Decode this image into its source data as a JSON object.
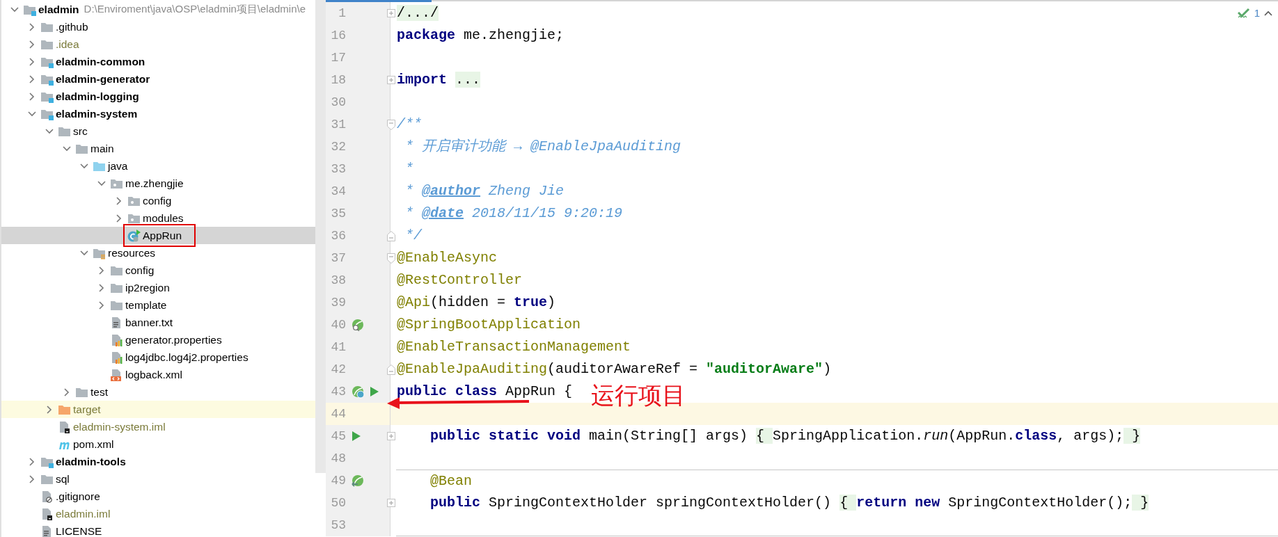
{
  "project_tree": [
    {
      "label": "eladmin",
      "path": "D:\\Enviroment\\java\\OSP\\eladmin项目\\eladmin\\e",
      "kind": "module",
      "expanded": true,
      "selected": false,
      "vcs_ignored": false,
      "highlighted": false,
      "callout_box": false,
      "children": [
        {
          "label": ".github",
          "kind": "folder",
          "expanded": false,
          "selected": false,
          "vcs_ignored": false,
          "highlighted": false,
          "callout_box": false
        },
        {
          "label": ".idea",
          "kind": "folder",
          "expanded": false,
          "selected": false,
          "vcs_ignored": true,
          "highlighted": false,
          "callout_box": false
        },
        {
          "label": "eladmin-common",
          "kind": "module",
          "expanded": false,
          "selected": false,
          "vcs_ignored": false,
          "highlighted": false,
          "callout_box": false
        },
        {
          "label": "eladmin-generator",
          "kind": "module",
          "expanded": false,
          "selected": false,
          "vcs_ignored": false,
          "highlighted": false,
          "callout_box": false
        },
        {
          "label": "eladmin-logging",
          "kind": "module",
          "expanded": false,
          "selected": false,
          "vcs_ignored": false,
          "highlighted": false,
          "callout_box": false
        },
        {
          "label": "eladmin-system",
          "kind": "module",
          "expanded": true,
          "selected": false,
          "vcs_ignored": false,
          "highlighted": false,
          "callout_box": false,
          "children": [
            {
              "label": "src",
              "kind": "folder",
              "expanded": true,
              "selected": false,
              "vcs_ignored": false,
              "highlighted": false,
              "callout_box": false,
              "children": [
                {
                  "label": "main",
                  "kind": "folder",
                  "expanded": true,
                  "selected": false,
                  "vcs_ignored": false,
                  "highlighted": false,
                  "callout_box": false,
                  "children": [
                    {
                      "label": "java",
                      "kind": "source",
                      "expanded": true,
                      "selected": false,
                      "vcs_ignored": false,
                      "highlighted": false,
                      "callout_box": false,
                      "children": [
                        {
                          "label": "me.zhengjie",
                          "kind": "package",
                          "expanded": true,
                          "selected": false,
                          "vcs_ignored": false,
                          "highlighted": false,
                          "callout_box": false,
                          "children": [
                            {
                              "label": "config",
                              "kind": "package",
                              "expanded": false,
                              "selected": false,
                              "vcs_ignored": false,
                              "highlighted": false,
                              "callout_box": false
                            },
                            {
                              "label": "modules",
                              "kind": "package",
                              "expanded": false,
                              "selected": false,
                              "vcs_ignored": false,
                              "highlighted": false,
                              "callout_box": false
                            },
                            {
                              "label": "AppRun",
                              "kind": "class",
                              "selected": true,
                              "vcs_ignored": false,
                              "highlighted": false,
                              "callout_box": true
                            }
                          ]
                        }
                      ]
                    },
                    {
                      "label": "resources",
                      "kind": "resources",
                      "expanded": true,
                      "selected": false,
                      "vcs_ignored": false,
                      "highlighted": false,
                      "callout_box": false,
                      "children": [
                        {
                          "label": "config",
                          "kind": "folder",
                          "expanded": false,
                          "selected": false,
                          "vcs_ignored": false,
                          "highlighted": false,
                          "callout_box": false
                        },
                        {
                          "label": "ip2region",
                          "kind": "folder",
                          "expanded": false,
                          "selected": false,
                          "vcs_ignored": false,
                          "highlighted": false,
                          "callout_box": false
                        },
                        {
                          "label": "template",
                          "kind": "folder",
                          "expanded": false,
                          "selected": false,
                          "vcs_ignored": false,
                          "highlighted": false,
                          "callout_box": false
                        },
                        {
                          "label": "banner.txt",
                          "kind": "text",
                          "selected": false,
                          "vcs_ignored": false,
                          "highlighted": false,
                          "callout_box": false
                        },
                        {
                          "label": "generator.properties",
                          "kind": "properties",
                          "selected": false,
                          "vcs_ignored": false,
                          "highlighted": false,
                          "callout_box": false
                        },
                        {
                          "label": "log4jdbc.log4j2.properties",
                          "kind": "properties",
                          "selected": false,
                          "vcs_ignored": false,
                          "highlighted": false,
                          "callout_box": false
                        },
                        {
                          "label": "logback.xml",
                          "kind": "xml",
                          "selected": false,
                          "vcs_ignored": false,
                          "highlighted": false,
                          "callout_box": false
                        }
                      ]
                    }
                  ]
                },
                {
                  "label": "test",
                  "kind": "folder",
                  "expanded": false,
                  "selected": false,
                  "vcs_ignored": false,
                  "highlighted": false,
                  "callout_box": false
                }
              ]
            },
            {
              "label": "target",
              "kind": "excluded",
              "expanded": false,
              "selected": false,
              "vcs_ignored": true,
              "highlighted": true,
              "callout_box": false
            },
            {
              "label": "eladmin-system.iml",
              "kind": "iml",
              "selected": false,
              "vcs_ignored": true,
              "highlighted": false,
              "callout_box": false
            },
            {
              "label": "pom.xml",
              "kind": "maven",
              "selected": false,
              "vcs_ignored": false,
              "highlighted": false,
              "callout_box": false
            }
          ]
        },
        {
          "label": "eladmin-tools",
          "kind": "module",
          "expanded": false,
          "selected": false,
          "vcs_ignored": false,
          "highlighted": false,
          "callout_box": false
        },
        {
          "label": "sql",
          "kind": "folder",
          "expanded": false,
          "selected": false,
          "vcs_ignored": false,
          "highlighted": false,
          "callout_box": false
        },
        {
          "label": ".gitignore",
          "kind": "ignore",
          "selected": false,
          "vcs_ignored": false,
          "highlighted": false,
          "callout_box": false
        },
        {
          "label": "eladmin.iml",
          "kind": "iml",
          "selected": false,
          "vcs_ignored": true,
          "highlighted": false,
          "callout_box": false
        },
        {
          "label": "LICENSE",
          "kind": "text",
          "selected": false,
          "vcs_ignored": false,
          "highlighted": false,
          "callout_box": false
        }
      ]
    }
  ],
  "editor": {
    "inspections": {
      "count": "1"
    },
    "lines": [
      {
        "number": "1",
        "fold": {
          "kind": "collapsed"
        },
        "current": false,
        "tokens": [
          {
            "kind": "folded",
            "text": "/.../"
          }
        ]
      },
      {
        "number": "16",
        "current": false,
        "tokens": [
          {
            "kind": "keyword",
            "text": "package"
          },
          {
            "kind": "plain",
            "text": " me.zhengjie;"
          }
        ]
      },
      {
        "number": "17",
        "current": false
      },
      {
        "number": "18",
        "fold": {
          "kind": "collapsed"
        },
        "current": false,
        "tokens": [
          {
            "kind": "keyword",
            "text": "import "
          },
          {
            "kind": "folded",
            "text": "..."
          }
        ]
      },
      {
        "number": "30",
        "current": false
      },
      {
        "number": "31",
        "fold": {
          "kind": "start"
        },
        "current": false,
        "tokens": [
          {
            "kind": "comment",
            "text": "/**"
          }
        ]
      },
      {
        "number": "32",
        "current": false,
        "tokens": [
          {
            "kind": "comment",
            "text": " * 开启审计功能 → @EnableJpaAuditing"
          }
        ]
      },
      {
        "number": "33",
        "current": false,
        "tokens": [
          {
            "kind": "comment",
            "text": " *"
          }
        ]
      },
      {
        "number": "34",
        "current": false,
        "tokens": [
          {
            "kind": "comment",
            "text": " * "
          },
          {
            "kind": "doctag",
            "text": "@author"
          },
          {
            "kind": "comment",
            "text": " Zheng Jie"
          }
        ]
      },
      {
        "number": "35",
        "current": false,
        "tokens": [
          {
            "kind": "comment",
            "text": " * "
          },
          {
            "kind": "doctag",
            "text": "@date"
          },
          {
            "kind": "comment",
            "text": " 2018/11/15 9:20:19"
          }
        ]
      },
      {
        "number": "36",
        "fold": {
          "kind": "end"
        },
        "current": false,
        "tokens": [
          {
            "kind": "comment",
            "text": " */"
          }
        ]
      },
      {
        "number": "37",
        "fold": {
          "kind": "start"
        },
        "current": false,
        "tokens": [
          {
            "kind": "annotation",
            "text": "@EnableAsync"
          }
        ]
      },
      {
        "number": "38",
        "current": false,
        "tokens": [
          {
            "kind": "annotation",
            "text": "@RestController"
          }
        ]
      },
      {
        "number": "39",
        "current": false,
        "tokens": [
          {
            "kind": "annotation",
            "text": "@Api"
          },
          {
            "kind": "plain",
            "text": "(hidden = "
          },
          {
            "kind": "keyword",
            "text": "true"
          },
          {
            "kind": "plain",
            "text": ")"
          }
        ]
      },
      {
        "number": "40",
        "gutter": [
          {
            "kind": "bean"
          }
        ],
        "current": false,
        "tokens": [
          {
            "kind": "annotation",
            "text": "@SpringBootApplication"
          }
        ]
      },
      {
        "number": "41",
        "current": false,
        "tokens": [
          {
            "kind": "annotation",
            "text": "@EnableTransactionManagement"
          }
        ]
      },
      {
        "number": "42",
        "fold": {
          "kind": "end"
        },
        "current": false,
        "tokens": [
          {
            "kind": "annotation",
            "text": "@EnableJpaAuditing"
          },
          {
            "kind": "plain",
            "text": "(auditorAwareRef = "
          },
          {
            "kind": "string",
            "text": "\"auditorAware\""
          },
          {
            "kind": "plain",
            "text": ")"
          }
        ]
      },
      {
        "number": "43",
        "gutter": [
          {
            "kind": "bean-class"
          },
          {
            "kind": "run"
          }
        ],
        "current": false,
        "callout": "运行项目",
        "tokens": [
          {
            "kind": "keyword",
            "text": "public class"
          },
          {
            "kind": "plain",
            "text": " AppRun {"
          }
        ]
      },
      {
        "number": "44",
        "current": true
      },
      {
        "number": "45",
        "gutter": [
          {
            "kind": "run"
          }
        ],
        "fold": {
          "kind": "collapsed"
        },
        "current": false,
        "tokens": [
          {
            "kind": "keyword",
            "text": "    public static void"
          },
          {
            "kind": "plain",
            "text": " main(String[] args) "
          },
          {
            "kind": "folded",
            "text": "{ "
          },
          {
            "kind": "plain",
            "text": "SpringApplication."
          },
          {
            "kind": "italic",
            "text": "run"
          },
          {
            "kind": "plain",
            "text": "(AppRun."
          },
          {
            "kind": "keyword",
            "text": "class"
          },
          {
            "kind": "plain",
            "text": ", args);"
          },
          {
            "kind": "folded",
            "text": " }"
          }
        ]
      },
      {
        "number": "48",
        "current": false
      },
      {
        "number": "49",
        "gutter": [
          {
            "kind": "bean-method"
          }
        ],
        "separator_above": true,
        "current": false,
        "tokens": [
          {
            "kind": "annotation",
            "text": "    @Bean"
          }
        ]
      },
      {
        "number": "50",
        "fold": {
          "kind": "collapsed"
        },
        "current": false,
        "tokens": [
          {
            "kind": "keyword",
            "text": "    public"
          },
          {
            "kind": "plain",
            "text": " SpringContextHolder springContextHolder() "
          },
          {
            "kind": "folded",
            "text": "{ "
          },
          {
            "kind": "keyword",
            "text": "return new"
          },
          {
            "kind": "plain",
            "text": " SpringContextHolder();"
          },
          {
            "kind": "folded",
            "text": " }"
          }
        ]
      },
      {
        "number": "53",
        "separator_below": true,
        "current": false
      }
    ]
  }
}
